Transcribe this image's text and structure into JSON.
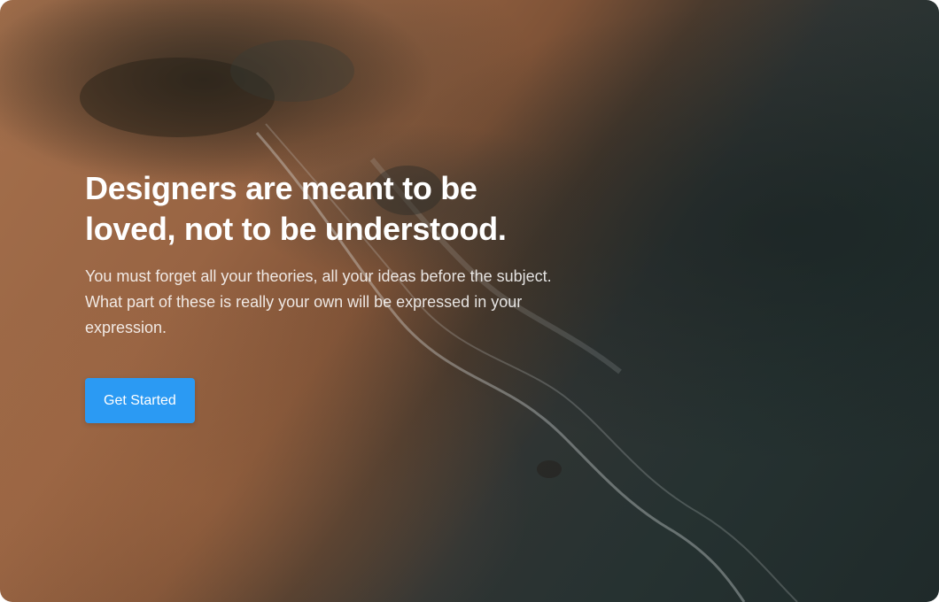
{
  "hero": {
    "headline_line1": "Designers are meant to be",
    "headline_line2": "loved, not to be understood.",
    "subtext": "You must forget all your theories, all your ideas before the subject. What part of these is really your own will be expressed in your expression.",
    "cta_label": "Get Started"
  },
  "colors": {
    "button": "#2b9af3",
    "sand": "#a5704c",
    "water": "#263231"
  },
  "icons": {
    "background": "beach-aerial-image"
  }
}
